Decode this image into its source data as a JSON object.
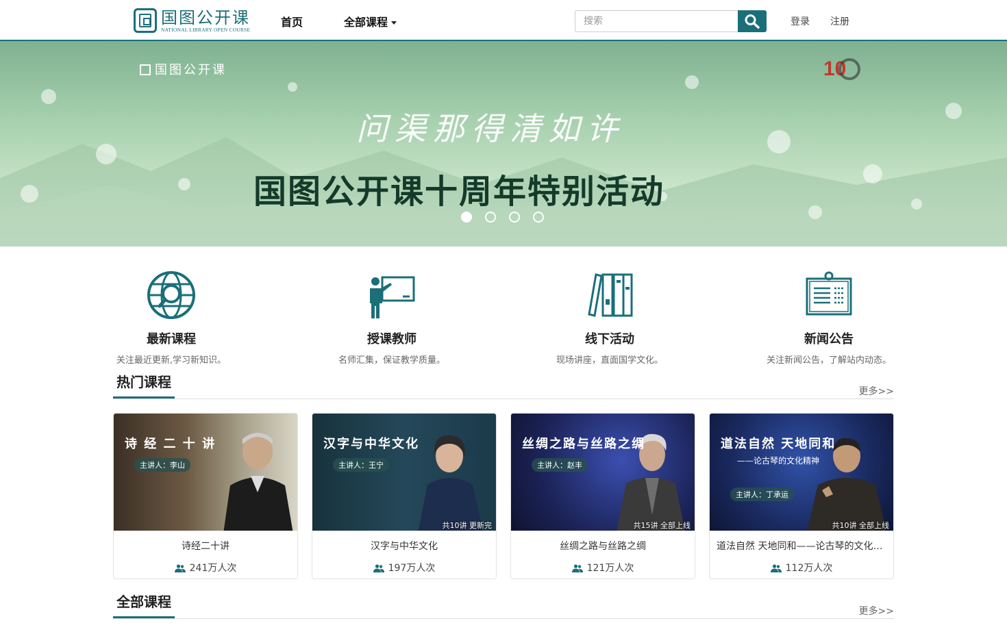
{
  "header": {
    "logo_cn": "国图公开课",
    "logo_en": "NATIONAL LIBRARY OPEN COURSE",
    "nav_home": "首页",
    "nav_courses": "全部课程",
    "search_placeholder": "搜索",
    "login": "登录",
    "register": "注册",
    "accent_color": "#1a6f79"
  },
  "banner": {
    "logo_text": "国图公开课",
    "slogan": "问渠那得清如许",
    "title": "国图公开课十周年特别活动",
    "anniversary_badge": "10",
    "slide_count": 4,
    "active_slide": 1
  },
  "features": [
    {
      "icon": "globe-search-icon",
      "title": "最新课程",
      "desc": "关注最近更新,学习新知识。"
    },
    {
      "icon": "teacher-board-icon",
      "title": "授课教师",
      "desc": "名师汇集，保证教学质量。"
    },
    {
      "icon": "books-icon",
      "title": "线下活动",
      "desc": "现场讲座，直面国学文化。"
    },
    {
      "icon": "news-board-icon",
      "title": "新闻公告",
      "desc": "关注新闻公告，了解站内动态。"
    }
  ],
  "hot_section": {
    "title": "热门课程",
    "more": "更多>>"
  },
  "all_section": {
    "title": "全部课程",
    "more": "更多>>"
  },
  "courses": [
    {
      "name": "诗经二十讲",
      "views": "241万人次",
      "thumb_title": "诗 经 二 十 讲",
      "thumb_speaker": "主讲人：李山",
      "thumb_sub": "",
      "thumb_badge": ""
    },
    {
      "name": "汉字与中华文化",
      "views": "197万人次",
      "thumb_title": "汉字与中华文化",
      "thumb_speaker": "主讲人：王宁",
      "thumb_sub": "",
      "thumb_badge": "共10讲  更新完"
    },
    {
      "name": "丝绸之路与丝路之绸",
      "views": "121万人次",
      "thumb_title": "丝绸之路与丝路之绸",
      "thumb_speaker": "主讲人：赵丰",
      "thumb_sub": "",
      "thumb_badge": "共15讲  全部上线"
    },
    {
      "name": "道法自然 天地同和——论古琴的文化精神",
      "views": "112万人次",
      "thumb_title": "道法自然  天地同和",
      "thumb_speaker": "主讲人：丁承运",
      "thumb_sub": "——论古琴的文化精神",
      "thumb_badge": "共10讲  全部上线"
    }
  ]
}
